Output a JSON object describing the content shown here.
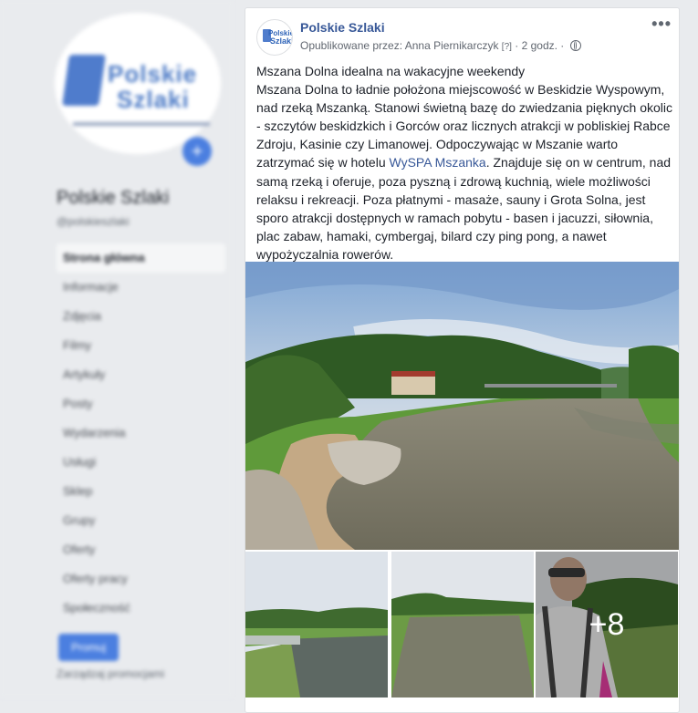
{
  "sidebar": {
    "avatar_text": [
      "Polskie",
      "Szlaki"
    ],
    "page_name": "Polskie Szlaki",
    "page_handle": "@polskieszlaki",
    "nav": [
      "Strona główna",
      "Informacje",
      "Zdjęcia",
      "Filmy",
      "Artykuły",
      "Posty",
      "Wydarzenia",
      "Usługi",
      "Sklep",
      "Grupy",
      "Oferty",
      "Oferty pracy",
      "Społeczność"
    ],
    "promote_label": "Promuj",
    "manage_label": "Zarządzaj promocjami"
  },
  "post": {
    "page_name": "Polskie Szlaki",
    "avatar_text": [
      "Polskie",
      "Szlaki"
    ],
    "published_by_prefix": "Opublikowane przez: ",
    "author": "Anna Piernikarczyk",
    "author_badge": "[?]",
    "time": "2 godz.",
    "more_label": "•••",
    "title_line": "Mszana Dolna idealna na wakacyjne weekendy",
    "body_part1": "Mszana Dolna to ładnie położona miejscowość w Beskidzie Wyspowym, nad rzeką Mszanką. Stanowi świetną bazę do zwiedzania pięknych okolic - szczytów beskidzkich i Gorców oraz licznych atrakcji w pobliskiej Rabce Zdroju, Kasinie czy Limanowej. Odpoczywając w Mszanie warto zatrzymać się w hotelu ",
    "body_link": "WySPA Mszanka",
    "body_part2": ". Znajduje się on w centrum, nad samą rzeką i oferuje, poza pyszną i zdrową kuchnią, wiele możliwości relaksu i rekreacji. Poza płatnymi - masaże, sauny i Grota Solna, jest sporo atrakcji dostępnych w ramach pobytu - basen i jacuzzi, siłownia, plac zabaw, hamaki, cymbergaj, bilard czy ping pong, a nawet wypożyczalnia rowerów.",
    "more_photos": "+8"
  },
  "colors": {
    "link": "#385898",
    "background": "#e9ebee",
    "card": "#ffffff"
  },
  "icons": [
    "globe-icon",
    "more-options-icon",
    "plus-icon"
  ]
}
